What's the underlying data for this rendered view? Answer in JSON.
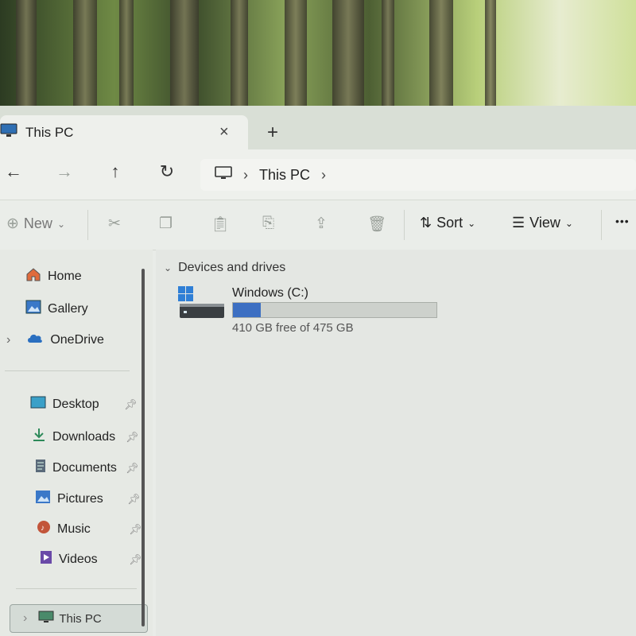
{
  "window": {
    "tab_title": "This PC",
    "close_glyph": "×",
    "new_tab_glyph": "+"
  },
  "nav": {
    "back": "←",
    "forward": "→",
    "up": "↑",
    "refresh": "↻",
    "address": {
      "location": "This PC",
      "sep": "›",
      "trail": "›"
    }
  },
  "toolbar": {
    "new_label": "New",
    "new_caret": "⌄",
    "sort_label": "Sort",
    "sort_caret": "⌄",
    "view_label": "View",
    "view_caret": "⌄",
    "more_glyph": "•••"
  },
  "sidebar": {
    "items": [
      {
        "label": "Home",
        "icon": "home-icon"
      },
      {
        "label": "Gallery",
        "icon": "gallery-icon"
      },
      {
        "label": "OneDrive",
        "icon": "cloud-icon",
        "expand": "›"
      }
    ],
    "pinned": [
      {
        "label": "Desktop",
        "icon": "desktop-icon"
      },
      {
        "label": "Downloads",
        "icon": "download-icon"
      },
      {
        "label": "Documents",
        "icon": "documents-icon"
      },
      {
        "label": "Pictures",
        "icon": "pictures-icon"
      },
      {
        "label": "Music",
        "icon": "music-icon"
      },
      {
        "label": "Videos",
        "icon": "videos-icon"
      }
    ],
    "this_pc": {
      "label": "This PC",
      "expand": "›"
    }
  },
  "content": {
    "section_label": "Devices and drives",
    "section_caret": "⌄",
    "drive": {
      "name": "Windows (C:)",
      "free_text": "410 GB free of 475 GB",
      "used_fraction": 0.137
    }
  },
  "colors": {
    "accent": "#3c6fc2",
    "background": "#e4e7e3"
  }
}
